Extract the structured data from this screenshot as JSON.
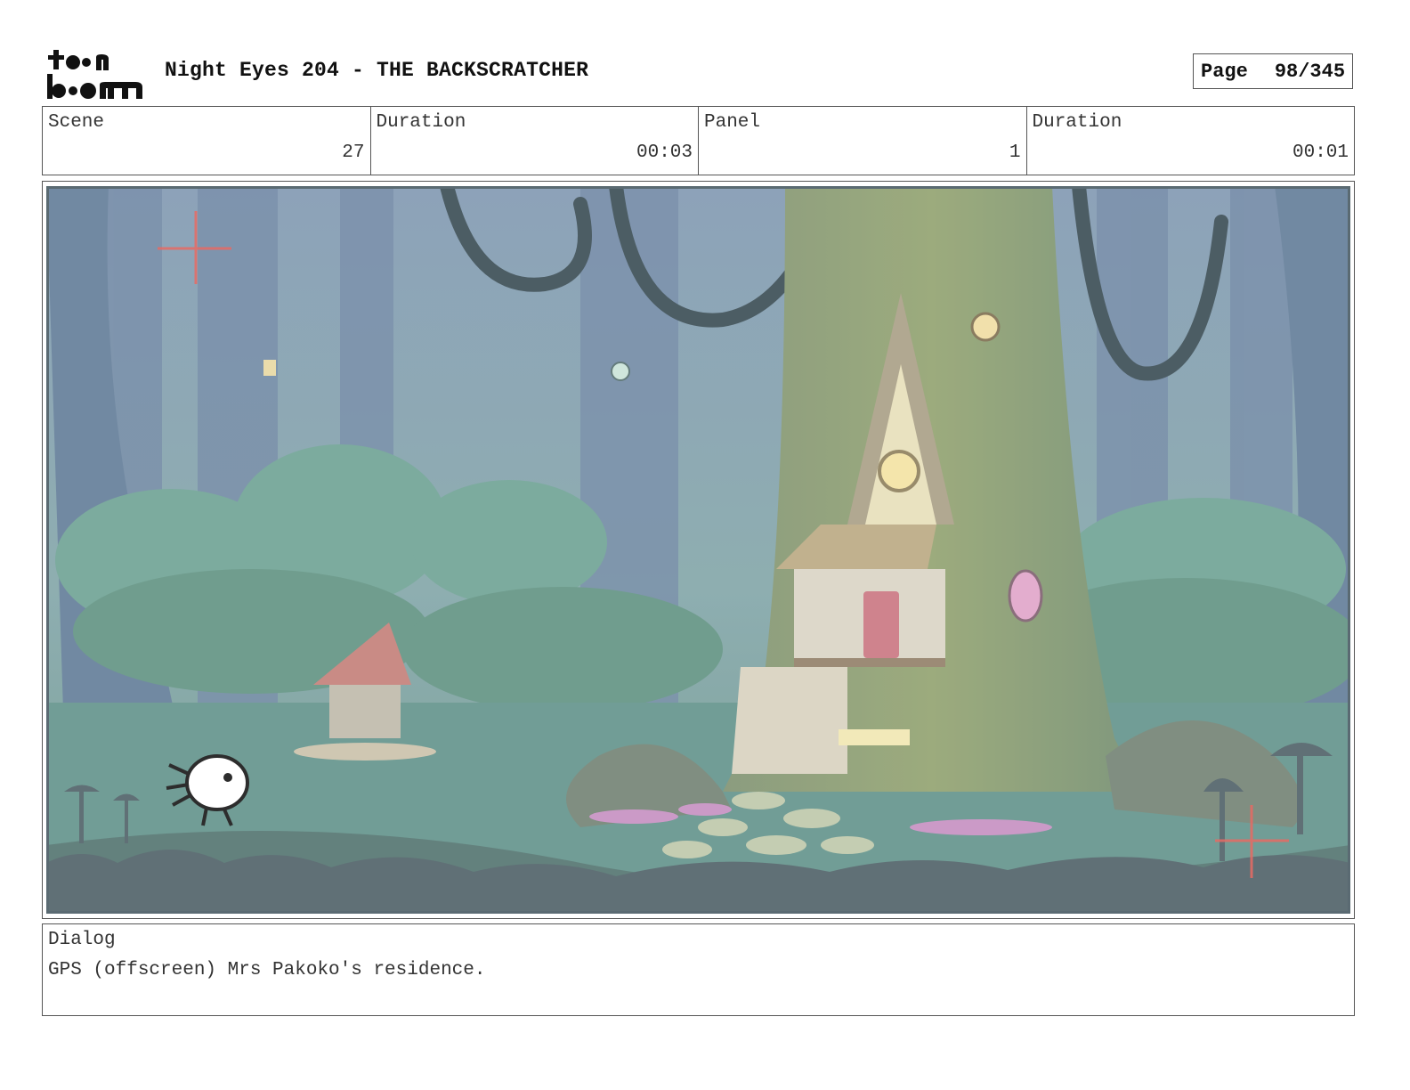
{
  "header": {
    "logo_text": "toonboom",
    "title": "Night Eyes 204 - THE BACKSCRATCHER",
    "page_label": "Page",
    "page_value": "98/345"
  },
  "info": {
    "scene_label": "Scene",
    "scene_value": "27",
    "scene_duration_label": "Duration",
    "scene_duration_value": "00:03",
    "panel_label": "Panel",
    "panel_value": "1",
    "panel_duration_label": "Duration",
    "panel_duration_value": "00:01"
  },
  "panel_image": {
    "icon": "forest-treehouse-illustration",
    "palette": {
      "sky": "#7f98ad",
      "foliage": "#6f9c8f",
      "trunk": "#7c9070",
      "ground": "#5f8f86",
      "door": "#c9727e",
      "crosshair": "#e4574f"
    }
  },
  "dialog": {
    "label": "Dialog",
    "text": "GPS (offscreen) Mrs Pakoko's residence."
  }
}
